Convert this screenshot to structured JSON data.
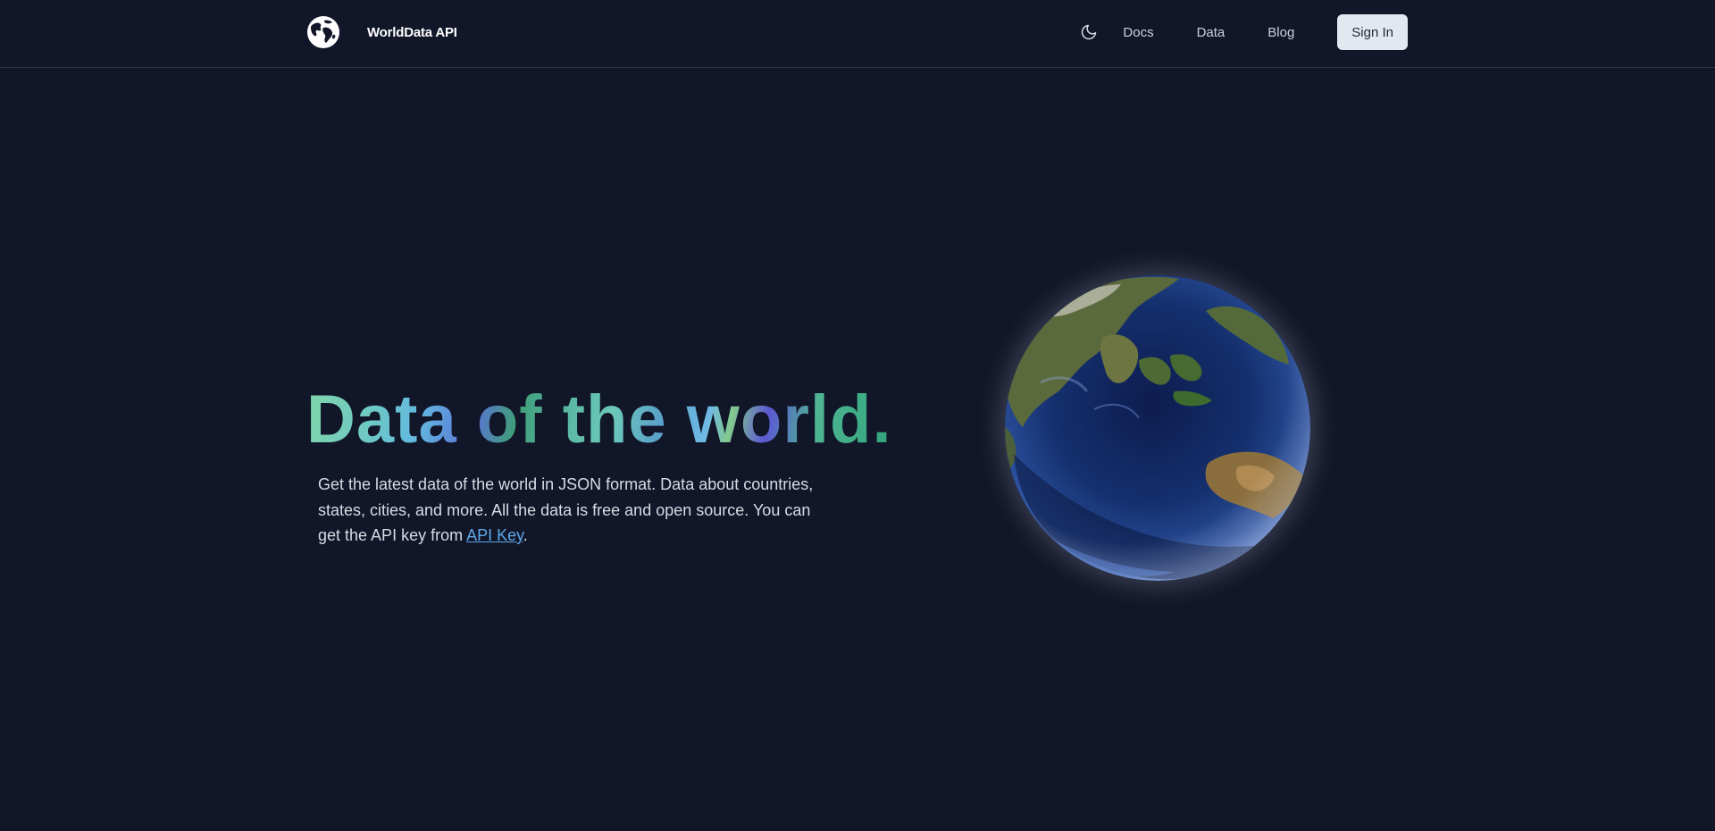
{
  "header": {
    "brand_name": "WorldData API",
    "nav_links": [
      {
        "label": "Docs"
      },
      {
        "label": "Data"
      },
      {
        "label": "Blog"
      }
    ],
    "signin_label": "Sign In",
    "theme_icon": "moon-icon",
    "logo_icon": "globe-logo-icon"
  },
  "hero": {
    "title": "Data of the world.",
    "description_prefix": "Get the latest data of the world in JSON format. Data about countries, states, cities, and more. All the data is free and open source. You can get the API key from ",
    "api_key_link": "API Key",
    "description_suffix": "."
  },
  "colors": {
    "background": "#111628",
    "link": "#5fa9e8",
    "signin_bg": "#e3e7f0"
  }
}
